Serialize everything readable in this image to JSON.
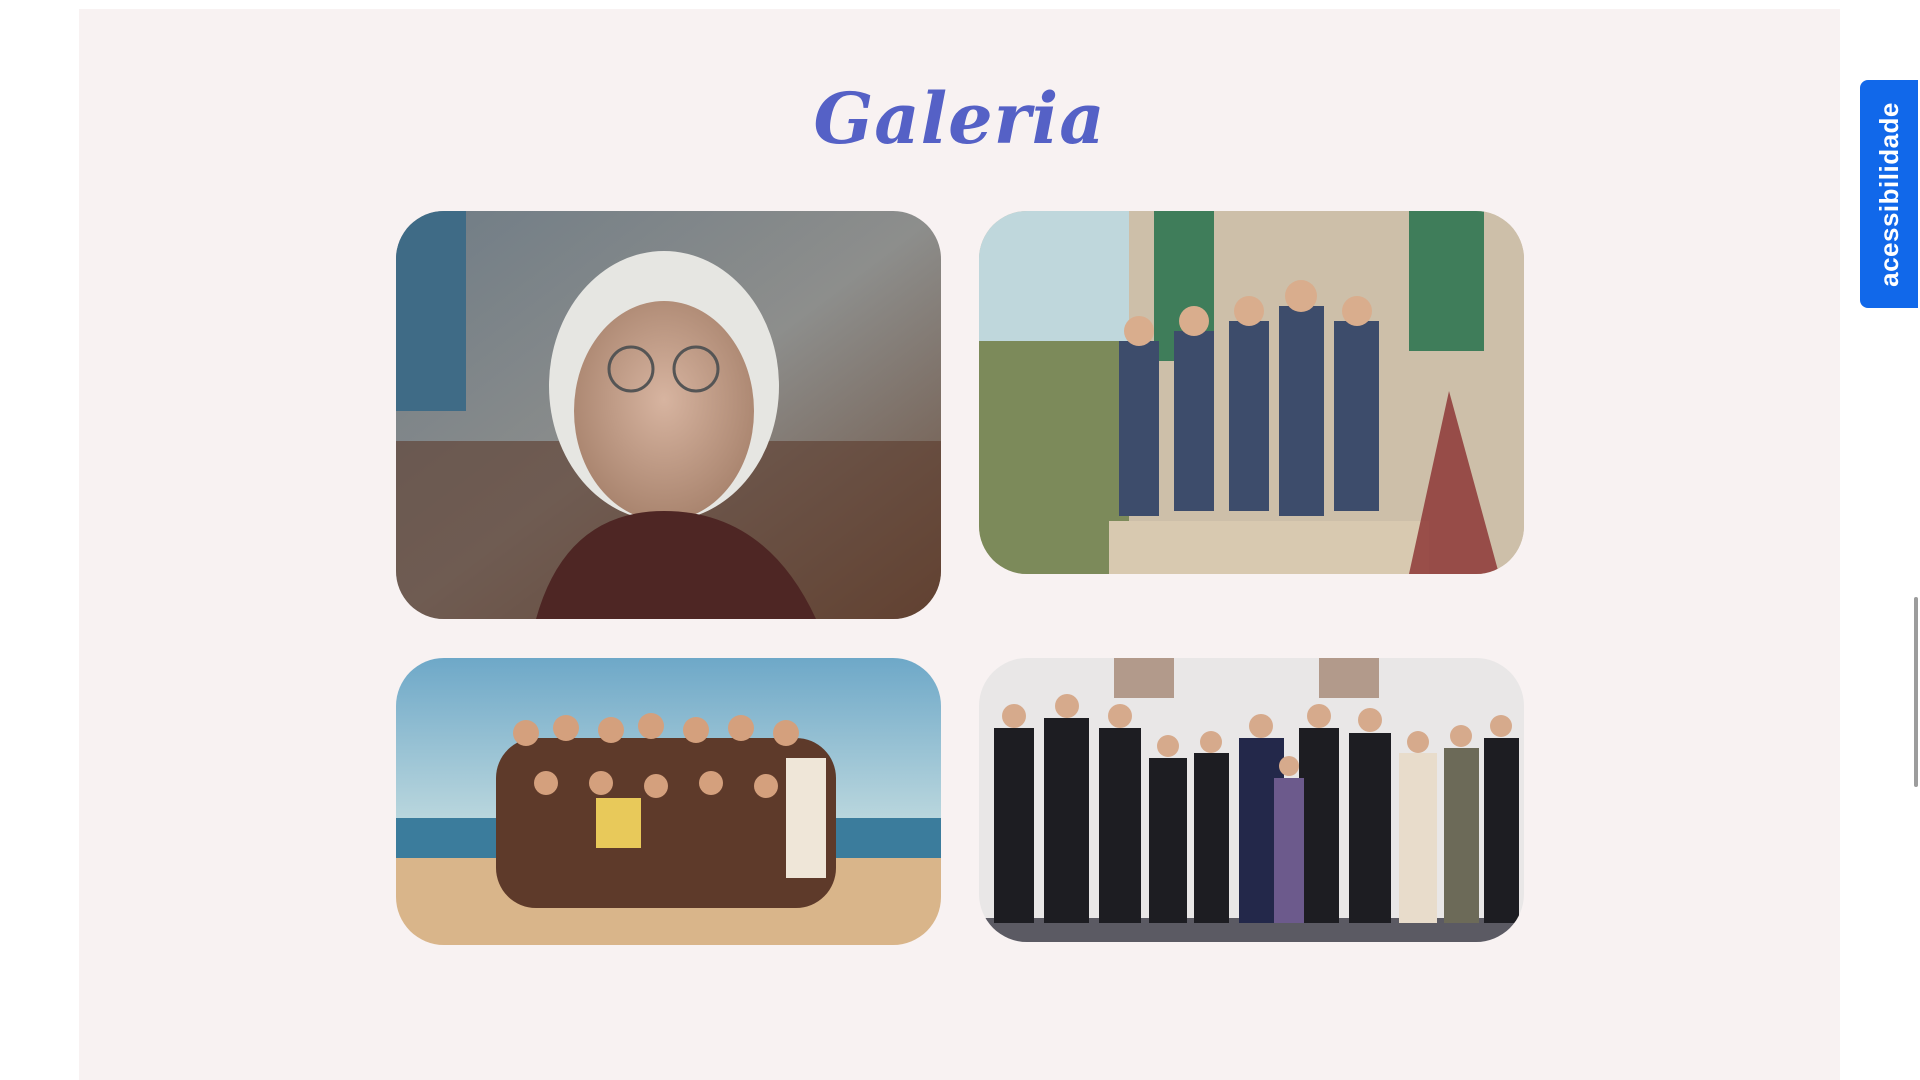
{
  "section": {
    "title": "Galeria"
  },
  "gallery": [
    {
      "name": "gallery-photo-elderly-woman",
      "alt": ""
    },
    {
      "name": "gallery-photo-family-porch",
      "alt": ""
    },
    {
      "name": "gallery-photo-group-beach",
      "alt": ""
    },
    {
      "name": "gallery-photo-cast-event",
      "alt": ""
    }
  ],
  "accessibility": {
    "label": "acessibilidade"
  },
  "colors": {
    "panel_bg": "#f8f2f2",
    "title": "#5561c6",
    "a11y_button": "#1168ea"
  }
}
